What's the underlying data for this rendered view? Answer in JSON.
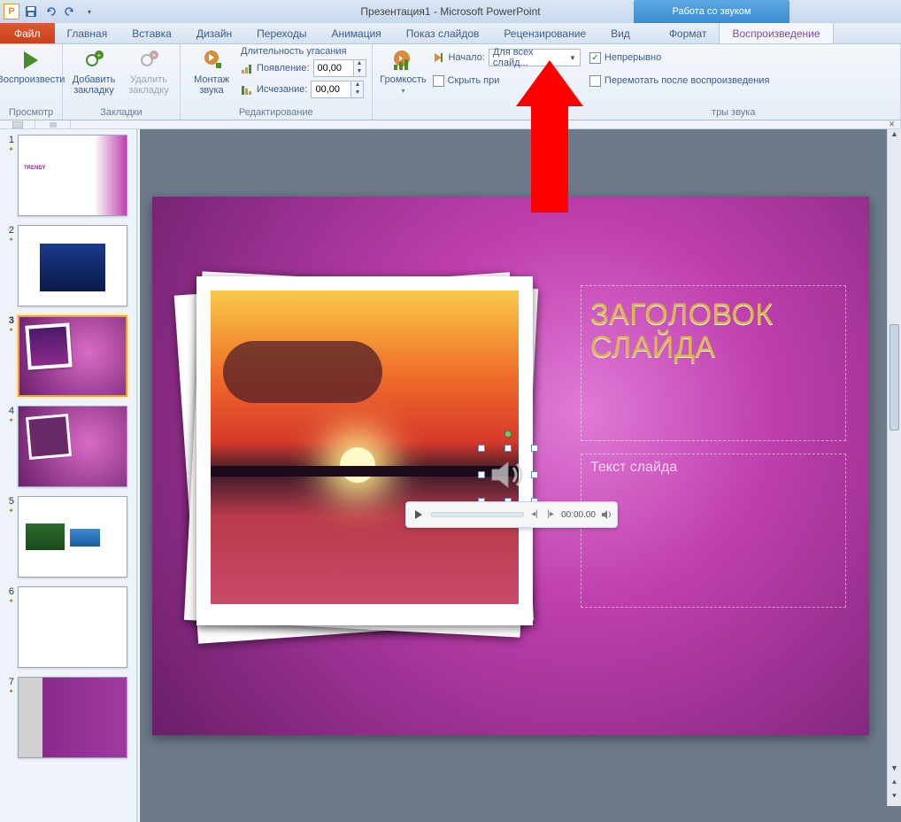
{
  "window_title": "Презентация1  -  Microsoft PowerPoint",
  "contextual_tab_title": "Работа со звуком",
  "tabs": {
    "file": "Файл",
    "home": "Главная",
    "insert": "Вставка",
    "design": "Дизайн",
    "transitions": "Переходы",
    "animations": "Анимация",
    "slideshow": "Показ слайдов",
    "review": "Рецензирование",
    "view": "Вид",
    "format": "Формат",
    "playback": "Воспроизведение"
  },
  "ribbon": {
    "preview_group": "Просмотр",
    "preview_btn": "Воспроизвести",
    "bookmarks_group": "Закладки",
    "add_bookmark": "Добавить закладку",
    "remove_bookmark": "Удалить закладку",
    "editing_group": "Редактирование",
    "trim_audio": "Монтаж звука",
    "fade_title": "Длительность угасания",
    "fade_in": "Появление:",
    "fade_out": "Исчезание:",
    "fade_in_val": "00,00",
    "fade_out_val": "00,00",
    "volume_btn": "Громкость",
    "start_label": "Начало:",
    "start_value": "Для всех слайд...",
    "hide_checkbox": "Скрыть при",
    "loop_checkbox": "Непрерывно",
    "rewind_checkbox": "Перемотать после воспроизведения",
    "audio_options_group": "тры звука"
  },
  "slide": {
    "title": "ЗАГОЛОВОК СЛАЙДА",
    "subtitle": "Текст слайда"
  },
  "audio_player": {
    "time": "00:00.00"
  },
  "thumbnails": [
    "1",
    "2",
    "3",
    "4",
    "5",
    "6",
    "7"
  ],
  "selected_slide": "3"
}
